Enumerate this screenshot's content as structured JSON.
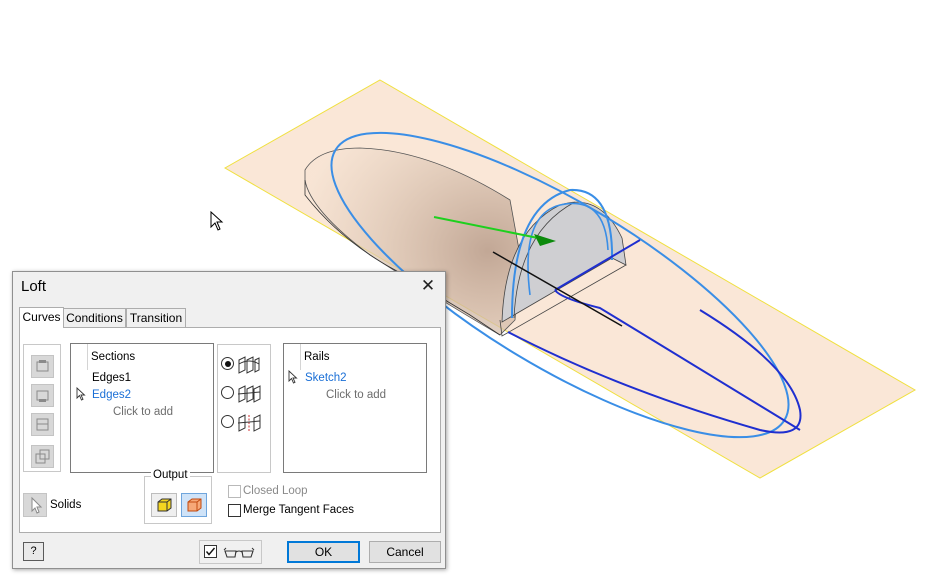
{
  "dialog": {
    "title": "Loft",
    "tabs": [
      {
        "label": "Curves",
        "active": true
      },
      {
        "label": "Conditions",
        "active": false
      },
      {
        "label": "Transition",
        "active": false
      }
    ],
    "sections": {
      "header": "Sections",
      "items": [
        "Edges1",
        "Edges2"
      ],
      "add_hint": "Click to add"
    },
    "rails": {
      "header": "Rails",
      "items": [
        "Sketch2"
      ],
      "add_hint": "Click to add"
    },
    "solids_label": "Solids",
    "output_label": "Output",
    "closed_loop_label": "Closed Loop",
    "merge_tangent_label": "Merge Tangent Faces",
    "preview_checked": true,
    "ok_label": "OK",
    "cancel_label": "Cancel",
    "help_icon": "?"
  },
  "colors": {
    "sketch_blue": "#3a8ee6",
    "rail_blue": "#1f2fd0",
    "work_plane": "#f9e3d0",
    "plane_edge": "#f0e040",
    "selected_text": "#1a6fd6",
    "default_button_border": "#0078d7"
  }
}
